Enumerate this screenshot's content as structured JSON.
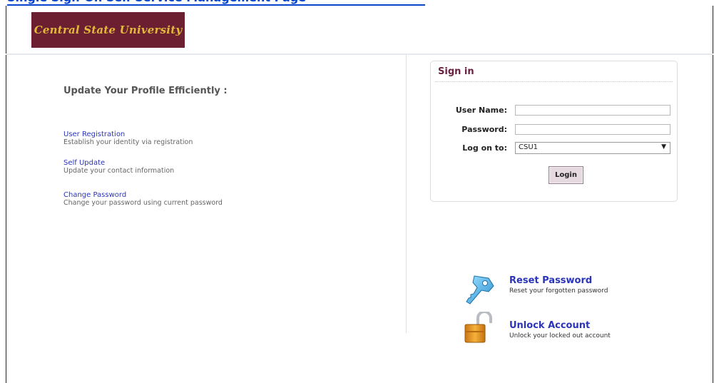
{
  "browser": {
    "top_link_text": "Single Sign-On Self Service Management Page"
  },
  "header": {
    "logo_text": "Central State University",
    "brand_color": "#6b1f31",
    "logo_text_color": "#e3b93c"
  },
  "left_panel": {
    "headline": "Update Your Profile Efficiently :",
    "links": [
      {
        "title": "User Registration",
        "description": "Establish your identity via registration"
      },
      {
        "title": "Self Update",
        "description": "Update your contact information"
      },
      {
        "title": "Change Password",
        "description": "Change your password using current password"
      }
    ]
  },
  "signin": {
    "title": "Sign in",
    "username_label": "User Name:",
    "username_value": "",
    "password_label": "Password:",
    "password_value": "",
    "logon_label": "Log on to:",
    "logon_selected": "CSU1",
    "login_button": "Login"
  },
  "actions": [
    {
      "icon": "key-icon",
      "title": "Reset Password",
      "description": "Reset your forgotten password"
    },
    {
      "icon": "padlock-icon",
      "title": "Unlock Account",
      "description": "Unlock your locked out account"
    }
  ]
}
